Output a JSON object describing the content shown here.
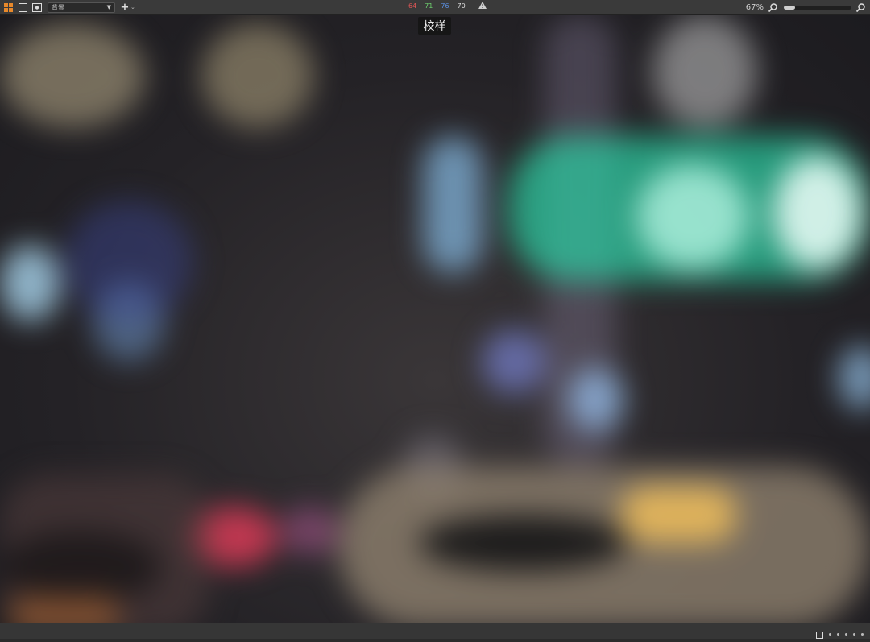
{
  "toolbar": {
    "layer_select_value": "背景",
    "readout": {
      "r": "64",
      "g": "71",
      "b": "76",
      "k": "70"
    },
    "zoom_label": "67%",
    "zoom_slider_level": 0.17
  },
  "viewer": {
    "proof_label": "校样"
  },
  "colors": {
    "accent": "#e8892b",
    "r": "#e05555",
    "g": "#6dcf6d",
    "b": "#5b8fe0",
    "k": "#dddddd"
  }
}
